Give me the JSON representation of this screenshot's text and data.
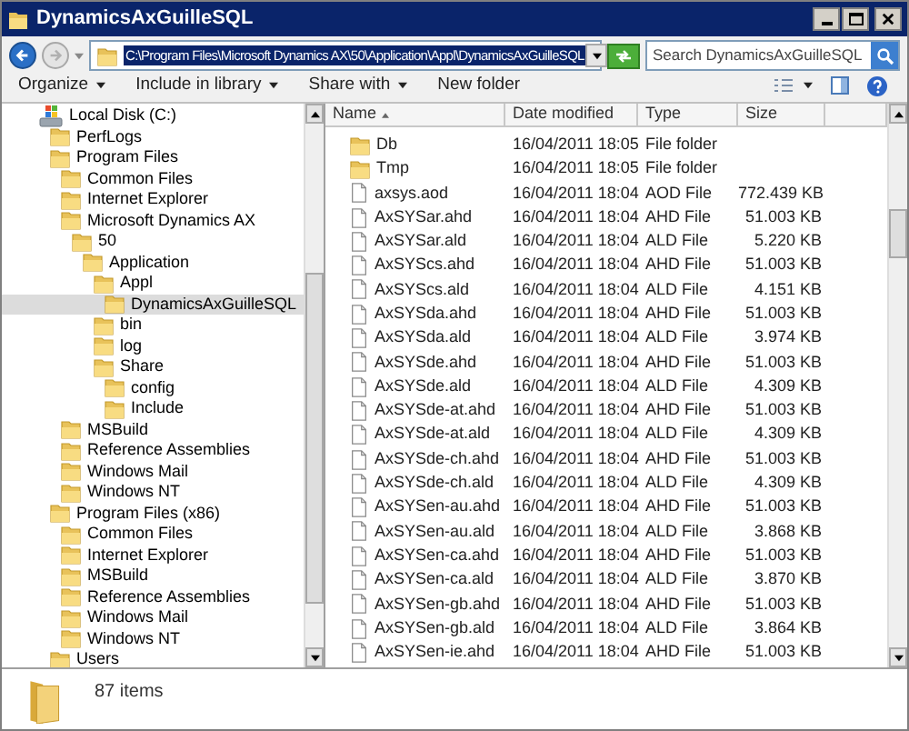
{
  "window": {
    "title": "DynamicsAxGuilleSQL"
  },
  "address": {
    "path": "C:\\Program Files\\Microsoft Dynamics AX\\50\\Application\\Appl\\DynamicsAxGuilleSQL"
  },
  "search": {
    "placeholder": "Search DynamicsAxGuilleSQL"
  },
  "toolbar": [
    {
      "label": "Organize",
      "dropdown": true
    },
    {
      "label": "Include in library",
      "dropdown": true
    },
    {
      "label": "Share with",
      "dropdown": true
    },
    {
      "label": "New folder",
      "dropdown": false
    }
  ],
  "tree": [
    {
      "label": "Local Disk (C:)",
      "kind": "drive",
      "selected": false,
      "children": [
        {
          "label": "PerfLogs",
          "kind": "folder",
          "selected": false
        },
        {
          "label": "Program Files",
          "kind": "folder",
          "selected": false,
          "children": [
            {
              "label": "Common Files",
              "kind": "folder",
              "selected": false
            },
            {
              "label": "Internet Explorer",
              "kind": "folder",
              "selected": false
            },
            {
              "label": "Microsoft Dynamics AX",
              "kind": "folder",
              "selected": false,
              "children": [
                {
                  "label": "50",
                  "kind": "folder",
                  "selected": false,
                  "children": [
                    {
                      "label": "Application",
                      "kind": "folder",
                      "selected": false,
                      "children": [
                        {
                          "label": "Appl",
                          "kind": "folder",
                          "selected": false,
                          "children": [
                            {
                              "label": "DynamicsAxGuilleSQL",
                              "kind": "folder",
                              "selected": true
                            }
                          ]
                        },
                        {
                          "label": "bin",
                          "kind": "folder",
                          "selected": false
                        },
                        {
                          "label": "log",
                          "kind": "folder",
                          "selected": false
                        },
                        {
                          "label": "Share",
                          "kind": "folder",
                          "selected": false,
                          "children": [
                            {
                              "label": "config",
                              "kind": "folder",
                              "selected": false
                            },
                            {
                              "label": "Include",
                              "kind": "folder",
                              "selected": false
                            }
                          ]
                        }
                      ]
                    }
                  ]
                }
              ]
            },
            {
              "label": "MSBuild",
              "kind": "folder",
              "selected": false
            },
            {
              "label": "Reference Assemblies",
              "kind": "folder",
              "selected": false
            },
            {
              "label": "Windows Mail",
              "kind": "folder",
              "selected": false
            },
            {
              "label": "Windows NT",
              "kind": "folder",
              "selected": false
            }
          ]
        },
        {
          "label": "Program Files (x86)",
          "kind": "folder",
          "selected": false,
          "children": [
            {
              "label": "Common Files",
              "kind": "folder",
              "selected": false
            },
            {
              "label": "Internet Explorer",
              "kind": "folder",
              "selected": false
            },
            {
              "label": "MSBuild",
              "kind": "folder",
              "selected": false
            },
            {
              "label": "Reference Assemblies",
              "kind": "folder",
              "selected": false
            },
            {
              "label": "Windows Mail",
              "kind": "folder",
              "selected": false
            },
            {
              "label": "Windows NT",
              "kind": "folder",
              "selected": false
            }
          ]
        },
        {
          "label": "Users",
          "kind": "folder",
          "selected": false
        }
      ]
    }
  ],
  "table": {
    "columns": [
      "Name",
      "Date modified",
      "Type",
      "Size"
    ],
    "rows": [
      {
        "kind": "folder",
        "name": "Db",
        "date": "16/04/2011 18:05",
        "type": "File folder"
      },
      {
        "kind": "folder",
        "name": "Tmp",
        "date": "16/04/2011 18:05",
        "type": "File folder"
      },
      {
        "kind": "file",
        "name": "axsys.aod",
        "date": "16/04/2011 18:04",
        "type": "AOD File",
        "size": "772.439 KB"
      },
      {
        "kind": "file",
        "name": "AxSYSar.ahd",
        "date": "16/04/2011 18:04",
        "type": "AHD File",
        "size": "51.003 KB"
      },
      {
        "kind": "file",
        "name": "AxSYSar.ald",
        "date": "16/04/2011 18:04",
        "type": "ALD File",
        "size": "5.220 KB"
      },
      {
        "kind": "file",
        "name": "AxSYScs.ahd",
        "date": "16/04/2011 18:04",
        "type": "AHD File",
        "size": "51.003 KB"
      },
      {
        "kind": "file",
        "name": "AxSYScs.ald",
        "date": "16/04/2011 18:04",
        "type": "ALD File",
        "size": "4.151 KB"
      },
      {
        "kind": "file",
        "name": "AxSYSda.ahd",
        "date": "16/04/2011 18:04",
        "type": "AHD File",
        "size": "51.003 KB"
      },
      {
        "kind": "file",
        "name": "AxSYSda.ald",
        "date": "16/04/2011 18:04",
        "type": "ALD File",
        "size": "3.974 KB"
      },
      {
        "kind": "file",
        "name": "AxSYSde.ahd",
        "date": "16/04/2011 18:04",
        "type": "AHD File",
        "size": "51.003 KB"
      },
      {
        "kind": "file",
        "name": "AxSYSde.ald",
        "date": "16/04/2011 18:04",
        "type": "ALD File",
        "size": "4.309 KB"
      },
      {
        "kind": "file",
        "name": "AxSYSde-at.ahd",
        "date": "16/04/2011 18:04",
        "type": "AHD File",
        "size": "51.003 KB"
      },
      {
        "kind": "file",
        "name": "AxSYSde-at.ald",
        "date": "16/04/2011 18:04",
        "type": "ALD File",
        "size": "4.309 KB"
      },
      {
        "kind": "file",
        "name": "AxSYSde-ch.ahd",
        "date": "16/04/2011 18:04",
        "type": "AHD File",
        "size": "51.003 KB"
      },
      {
        "kind": "file",
        "name": "AxSYSde-ch.ald",
        "date": "16/04/2011 18:04",
        "type": "ALD File",
        "size": "4.309 KB"
      },
      {
        "kind": "file",
        "name": "AxSYSen-au.ahd",
        "date": "16/04/2011 18:04",
        "type": "AHD File",
        "size": "51.003 KB"
      },
      {
        "kind": "file",
        "name": "AxSYSen-au.ald",
        "date": "16/04/2011 18:04",
        "type": "ALD File",
        "size": "3.868 KB"
      },
      {
        "kind": "file",
        "name": "AxSYSen-ca.ahd",
        "date": "16/04/2011 18:04",
        "type": "AHD File",
        "size": "51.003 KB"
      },
      {
        "kind": "file",
        "name": "AxSYSen-ca.ald",
        "date": "16/04/2011 18:04",
        "type": "ALD File",
        "size": "3.870 KB"
      },
      {
        "kind": "file",
        "name": "AxSYSen-gb.ahd",
        "date": "16/04/2011 18:04",
        "type": "AHD File",
        "size": "51.003 KB"
      },
      {
        "kind": "file",
        "name": "AxSYSen-gb.ald",
        "date": "16/04/2011 18:04",
        "type": "ALD File",
        "size": "3.864 KB"
      },
      {
        "kind": "file",
        "name": "AxSYSen-ie.ahd",
        "date": "16/04/2011 18:04",
        "type": "AHD File",
        "size": "51.003 KB"
      }
    ]
  },
  "status_bar": {
    "count": "87 items"
  }
}
